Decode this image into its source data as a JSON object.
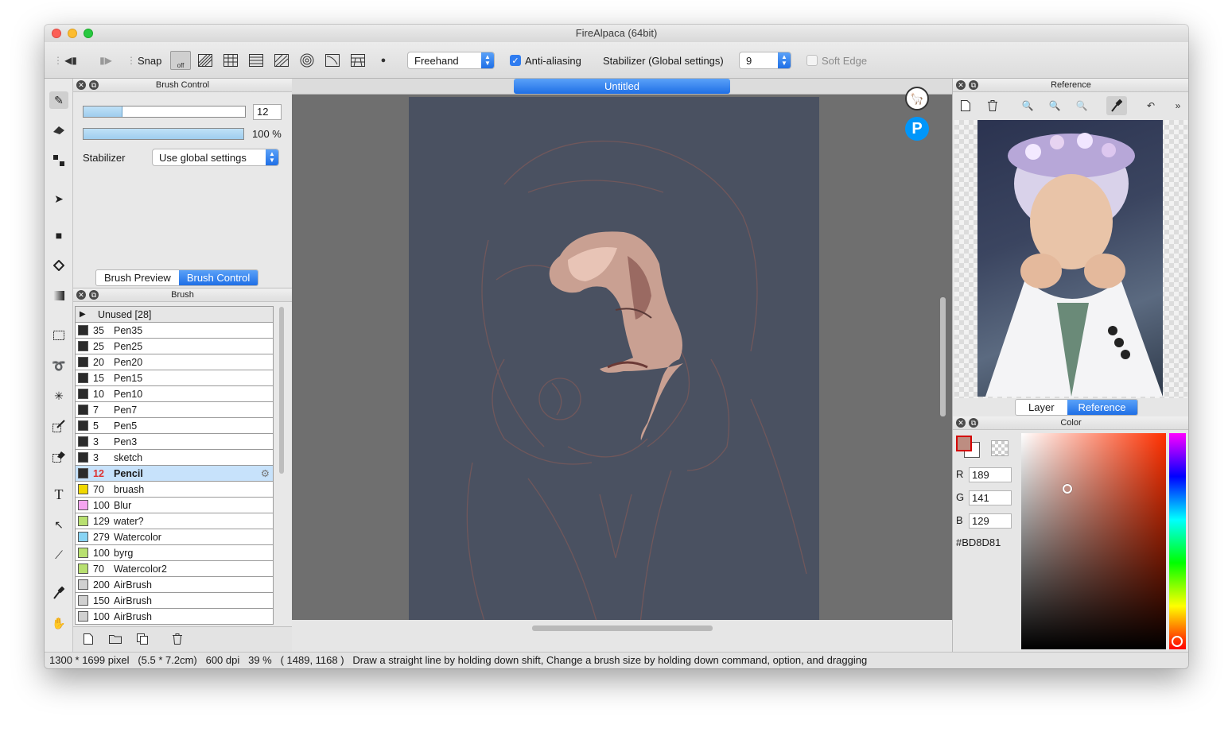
{
  "window": {
    "title": "FireAlpaca (64bit)"
  },
  "toolbar": {
    "snap_label": "Snap",
    "snap_off_label": "off",
    "draw_mode": "Freehand",
    "antialias_label": "Anti-aliasing",
    "stabilizer_label": "Stabilizer (Global settings)",
    "stabilizer_value": "9",
    "soft_edge_label": "Soft Edge"
  },
  "brush_control": {
    "title": "Brush Control",
    "size_value": "12",
    "size_fraction": 0.24,
    "opacity_value": "100 %",
    "opacity_fraction": 1.0,
    "stabilizer_label": "Stabilizer",
    "stabilizer_value": "Use global settings",
    "tab_preview": "Brush Preview",
    "tab_control": "Brush Control"
  },
  "brush_panel": {
    "title": "Brush",
    "group": "Unused [28]",
    "items": [
      {
        "size": "35",
        "name": "Pen35",
        "color": "#2b2b2b"
      },
      {
        "size": "25",
        "name": "Pen25",
        "color": "#2b2b2b"
      },
      {
        "size": "20",
        "name": "Pen20",
        "color": "#2b2b2b"
      },
      {
        "size": "15",
        "name": "Pen15",
        "color": "#2b2b2b"
      },
      {
        "size": "10",
        "name": "Pen10",
        "color": "#2b2b2b"
      },
      {
        "size": "7",
        "name": "Pen7",
        "color": "#2b2b2b"
      },
      {
        "size": "5",
        "name": "Pen5",
        "color": "#2b2b2b"
      },
      {
        "size": "3",
        "name": "Pen3",
        "color": "#2b2b2b"
      },
      {
        "size": "3",
        "name": "sketch",
        "color": "#2b2b2b"
      },
      {
        "size": "12",
        "name": "Pencil",
        "color": "#2b2b2b",
        "selected": true
      },
      {
        "size": "70",
        "name": "bruash",
        "color": "#f0d800"
      },
      {
        "size": "100",
        "name": "Blur",
        "color": "#f4a4f0"
      },
      {
        "size": "129",
        "name": "water?",
        "color": "#b8e070"
      },
      {
        "size": "279",
        "name": "Watercolor",
        "color": "#88d4f4"
      },
      {
        "size": "100",
        "name": "byrg",
        "color": "#b8e070"
      },
      {
        "size": "70",
        "name": "Watercolor2",
        "color": "#b8e070"
      },
      {
        "size": "200",
        "name": "AirBrush",
        "color": "#d0d0d0"
      },
      {
        "size": "150",
        "name": "AirBrush",
        "color": "#d0d0d0"
      },
      {
        "size": "100",
        "name": "AirBrush",
        "color": "#d0d0d0"
      }
    ]
  },
  "canvas": {
    "tab_title": "Untitled",
    "bg_color": "#4a5161"
  },
  "reference": {
    "title": "Reference",
    "tab_layer": "Layer",
    "tab_reference": "Reference"
  },
  "color": {
    "title": "Color",
    "r_label": "R",
    "r_value": "189",
    "g_label": "G",
    "g_value": "141",
    "b_label": "B",
    "b_value": "129",
    "hex": "#BD8D81",
    "current": "#bd8d81"
  },
  "status": {
    "dimensions": "1300 * 1699 pixel",
    "physical": "(5.5 * 7.2cm)",
    "dpi": "600 dpi",
    "zoom": "39 %",
    "cursor": "( 1489, 1168 )",
    "hint": "Draw a straight line by holding down shift, Change a brush size by holding down command, option, and dragging"
  }
}
